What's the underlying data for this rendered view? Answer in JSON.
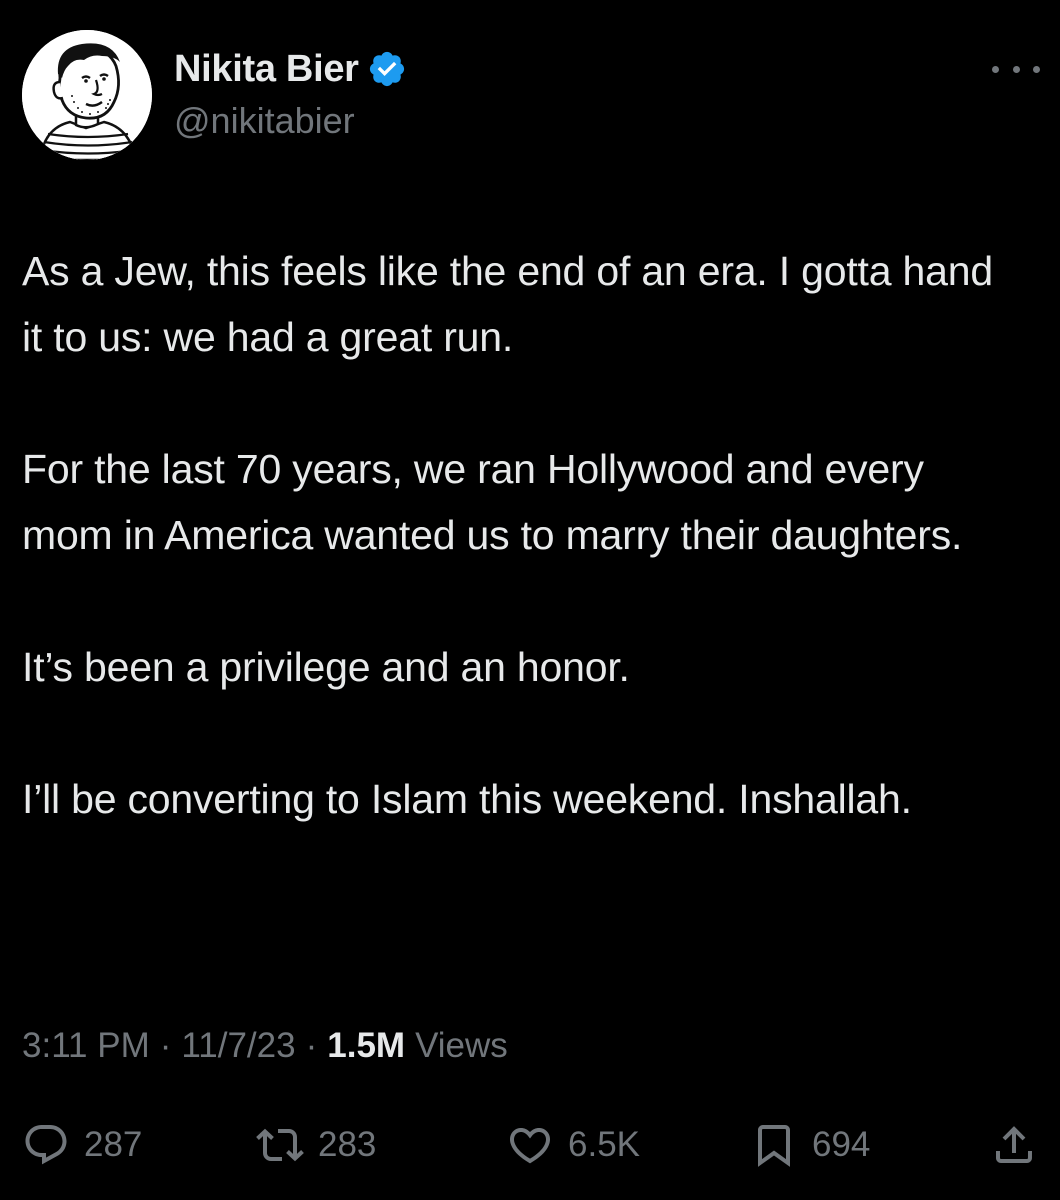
{
  "author": {
    "name": "Nikita Bier",
    "handle": "@nikitabier",
    "verified": true
  },
  "tweet": {
    "paragraphs": [
      "As a Jew, this feels like the end of an era. I gotta hand it to us: we had a great run.",
      "For the last 70 years, we ran Hollywood and every mom in America wanted us to marry their daughters.",
      "It’s been a privilege and an honor.",
      "I’ll be converting to Islam this weekend. Inshallah."
    ]
  },
  "meta": {
    "time": "3:11 PM",
    "separator": "·",
    "date": "11/7/23",
    "views_count": "1.5M",
    "views_label": "Views"
  },
  "actions": {
    "replies": "287",
    "reposts": "283",
    "likes": "6.5K",
    "bookmarks": "694"
  },
  "icons": {
    "verified": "verified-badge-icon",
    "more": "more-icon",
    "reply": "reply-icon",
    "repost": "repost-icon",
    "like": "heart-icon",
    "bookmark": "bookmark-icon",
    "share": "share-icon"
  },
  "colors": {
    "background": "#000000",
    "text_primary": "#e7e9ea",
    "text_secondary": "#71767b",
    "verified_blue": "#1d9bf0"
  }
}
